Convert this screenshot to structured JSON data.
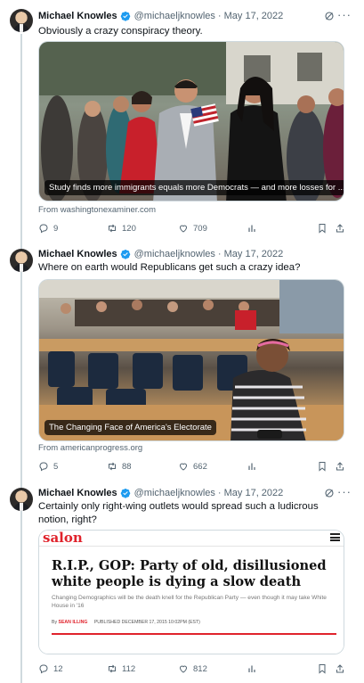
{
  "author": {
    "name": "Michael Knowles",
    "handle": "@michaeljknowles",
    "verified_color": "#1d9bf0"
  },
  "tweets": [
    {
      "date": "· May 17, 2022",
      "text": "Obviously a crazy conspiracy theory.",
      "card_caption": "Study finds more immigrants equals more Democrats — and more losses for ...",
      "source": "From washingtonexaminer.com",
      "replies": "9",
      "retweets": "120",
      "likes": "709"
    },
    {
      "date": "· May 17, 2022",
      "text": "Where on earth would Republicans get such a crazy idea?",
      "card_caption": "The Changing Face of America's Electorate",
      "source": "From americanprogress.org",
      "replies": "5",
      "retweets": "88",
      "likes": "662"
    },
    {
      "date": "· May 17, 2022",
      "text": "Certainly only right-wing outlets would spread such a ludicrous notion, right?",
      "replies": "12",
      "retweets": "112",
      "likes": "812",
      "salon": {
        "logo": "salon",
        "headline": "R.I.P., GOP: Party of old, disillusioned white people is dying a slow death",
        "dek": "Changing Demographics will be the death knell for the Republican Party — even though it may take White House in '16",
        "byline_prefix": "By",
        "byline_author": "SEAN ILLING",
        "byline_date": "PUBLISHED DECEMBER 17, 2015 10:02PM (EST)"
      }
    }
  ],
  "icons": {
    "reply": "reply-icon",
    "retweet": "retweet-icon",
    "like": "heart-icon",
    "views": "analytics-icon",
    "bookmark": "bookmark-icon",
    "share": "share-icon",
    "grok": "grok-icon",
    "more": "more-icon"
  },
  "colors": {
    "text": "#0f1419",
    "muted": "#536471",
    "border": "#cfd9de",
    "salon_red": "#e0232c"
  }
}
